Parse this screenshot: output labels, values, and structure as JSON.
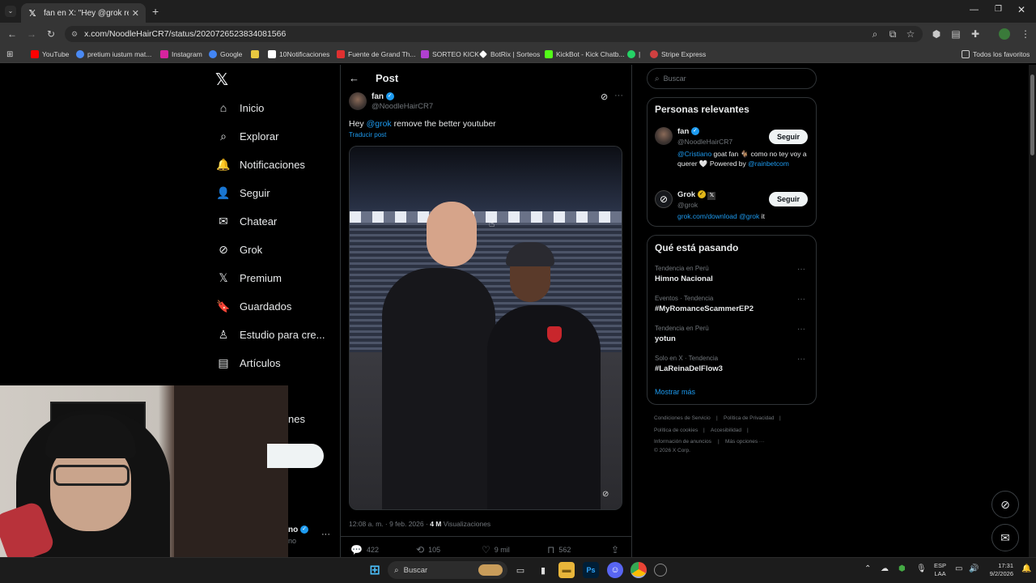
{
  "browser": {
    "tab_title": "fan en X: \"Hey @grok remove t",
    "url": "x.com/NoodleHairCR7/status/2020726523834081566",
    "bookmarks": [
      {
        "label": "YouTube",
        "color": "#ff0000"
      },
      {
        "label": "pretium iustum mat...",
        "color": "#4a8af4"
      },
      {
        "label": "Instagram",
        "color": "#d6249f"
      },
      {
        "label": "Google",
        "color": "#4285f4"
      },
      {
        "label": "",
        "color": "#e8c840"
      },
      {
        "label": "10Notificaciones",
        "color": "#ffffff"
      },
      {
        "label": "Fuente de Grand Th...",
        "color": "#e03030"
      },
      {
        "label": "SORTEO KICK",
        "color": "#b040d0"
      },
      {
        "label": "BotRix | Sorteos",
        "color": "#ffffff"
      },
      {
        "label": "KickBot - Kick Chatb...",
        "color": "#53fc18"
      },
      {
        "label": "|",
        "color": "#25d366"
      },
      {
        "label": "Stripe Express",
        "color": "#d04040"
      }
    ],
    "all_bookmarks": "Todos los favoritos"
  },
  "nav": {
    "items": [
      {
        "label": "Inicio",
        "icon": "home-icon",
        "glyph": "⌂"
      },
      {
        "label": "Explorar",
        "icon": "search-icon",
        "glyph": "⌕"
      },
      {
        "label": "Notificaciones",
        "icon": "bell-icon",
        "glyph": "🔔"
      },
      {
        "label": "Seguir",
        "icon": "follow-icon",
        "glyph": "👤"
      },
      {
        "label": "Chatear",
        "icon": "mail-icon",
        "glyph": "✉"
      },
      {
        "label": "Grok",
        "icon": "grok-icon",
        "glyph": "⊘"
      },
      {
        "label": "Premium",
        "icon": "x-logo-icon",
        "glyph": "𝕏"
      },
      {
        "label": "Guardados",
        "icon": "bookmark-icon",
        "glyph": "🔖"
      },
      {
        "label": "Estudio para cre...",
        "icon": "studio-icon",
        "glyph": "♙"
      },
      {
        "label": "Artículos",
        "icon": "articles-icon",
        "glyph": "▤"
      }
    ],
    "partial_more": "nes",
    "partial_account": "no",
    "partial_handle": "no"
  },
  "post": {
    "header_title": "Post",
    "author_name": "fan",
    "author_handle": "@NoodleHairCR7",
    "text_prefix": "Hey ",
    "text_mention": "@grok",
    "text_suffix": " remove the better youtuber",
    "translate": "Traducir post",
    "time": "12:08 a. m. · 9 feb. 2026 ·",
    "views_count": "4 M",
    "views_label": "Visualizaciones",
    "replies": "422",
    "reposts": "105",
    "likes": "9 mil",
    "bookmarks": "562"
  },
  "sidebar": {
    "search_placeholder": "Buscar",
    "relevant_title": "Personas relevantes",
    "people": [
      {
        "name": "fan",
        "handle": "@NoodleHairCR7",
        "follow": "Seguir",
        "bio_mention": "@Cristiano",
        "bio_text": " goat fan 🐐 como no tey voy a querer 🤍 Powered by",
        "bio_link": "@rainbetcom"
      },
      {
        "name": "Grok",
        "handle": "@grok",
        "follow": "Seguir",
        "bio_link": "grok.com/download",
        "bio_mention": "@grok",
        "bio_text": " it"
      }
    ],
    "trending_title": "Qué está pasando",
    "trends": [
      {
        "category": "Tendencia en Perú",
        "name": "Himno Nacional"
      },
      {
        "category": "Eventos · Tendencia",
        "name": "#MyRomanceScammerEP2"
      },
      {
        "category": "Tendencia en Perú",
        "name": "yotun"
      },
      {
        "category": "Solo en X · Tendencia",
        "name": "#LaReinaDelFlow3"
      }
    ],
    "show_more": "Mostrar más",
    "footer": {
      "terms": "Condiciones de Servicio",
      "privacy": "Política de Privacidad",
      "cookies": "Política de cookies",
      "access": "Accesibilidad",
      "ads": "Información de anuncios",
      "more": "Más opciones ···",
      "copy": "© 2026 X Corp."
    }
  },
  "taskbar": {
    "search": "Buscar",
    "lang_top": "ESP",
    "lang_bottom": "LAA",
    "time": "17:31",
    "date": "9/2/2026"
  }
}
